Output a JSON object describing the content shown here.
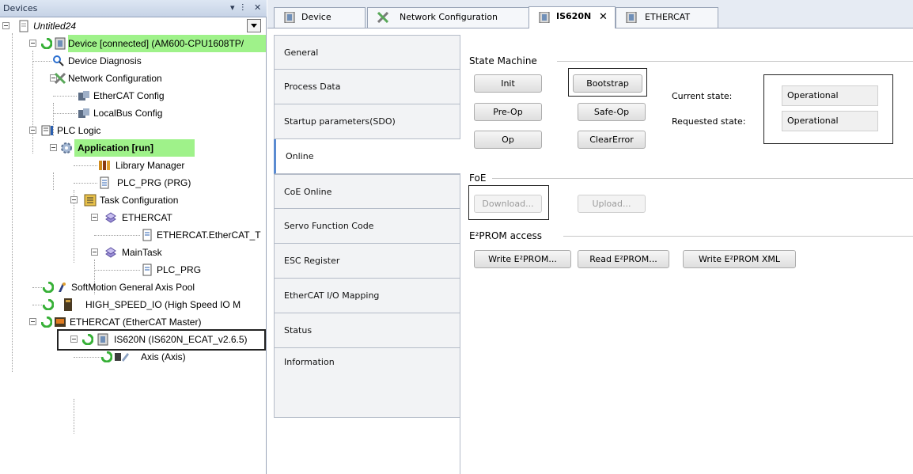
{
  "devices_pane": {
    "title": "Devices",
    "controls": {
      "menu": "▾",
      "pin": "ⵗ",
      "close": "✕"
    },
    "tree": {
      "root": "Untitled24",
      "device": "Device [connected] (AM600-CPU1608TP/",
      "device_diagnosis": "Device Diagnosis",
      "network_configuration": "Network Configuration",
      "ethercat_config": "EtherCAT Config",
      "localbus_config": "LocalBus Config",
      "plc_logic": "PLC Logic",
      "application": "Application [run]",
      "library_manager": "Library Manager",
      "plc_prg": "PLC_PRG (PRG)",
      "task_configuration": "Task Configuration",
      "task_ethercat": "ETHERCAT",
      "ethercat_task_call": "ETHERCAT.EtherCAT_T",
      "main_task": "MainTask",
      "main_task_call": "PLC_PRG",
      "softmotion_pool": "SoftMotion General Axis Pool",
      "high_speed_io": "HIGH_SPEED_IO (High Speed IO M",
      "ethercat_master": "ETHERCAT (EtherCAT Master)",
      "is620n": "IS620N (IS620N_ECAT_v2.6.5)",
      "axis": "Axis (Axis)"
    }
  },
  "editor_tabs": [
    {
      "label": "Device",
      "active": false
    },
    {
      "label": "Network Configuration",
      "active": false
    },
    {
      "label": "IS620N",
      "active": true,
      "close": "✕"
    },
    {
      "label": "ETHERCAT",
      "active": false
    }
  ],
  "side_tabs": [
    {
      "label": "General"
    },
    {
      "label": "Process Data"
    },
    {
      "label": "Startup parameters(SDO)"
    },
    {
      "label": "Online",
      "active": true
    },
    {
      "label": "CoE Online"
    },
    {
      "label": "Servo Function Code"
    },
    {
      "label": "ESC Register"
    },
    {
      "label": "EtherCAT I/O Mapping"
    },
    {
      "label": "Status"
    },
    {
      "label": "Information"
    }
  ],
  "state_machine": {
    "title": "State Machine",
    "buttons": {
      "init": "Init",
      "bootstrap": "Bootstrap",
      "pre_op": "Pre-Op",
      "safe_op": "Safe-Op",
      "op": "Op",
      "clear_error": "ClearError"
    },
    "current_state_label": "Current state:",
    "current_state_value": "Operational",
    "requested_state_label": "Requested state:",
    "requested_state_value": "Operational"
  },
  "foe": {
    "title": "FoE",
    "download": "Download...",
    "upload": "Upload..."
  },
  "eeprom": {
    "title": "E²PROM access",
    "write": "Write E²PROM...",
    "read": "Read E²PROM...",
    "write_xml": "Write E²PROM XML"
  },
  "colors": {
    "connected_highlight": "#9ff28a",
    "active_tab_accent": "#5b8bd1"
  }
}
